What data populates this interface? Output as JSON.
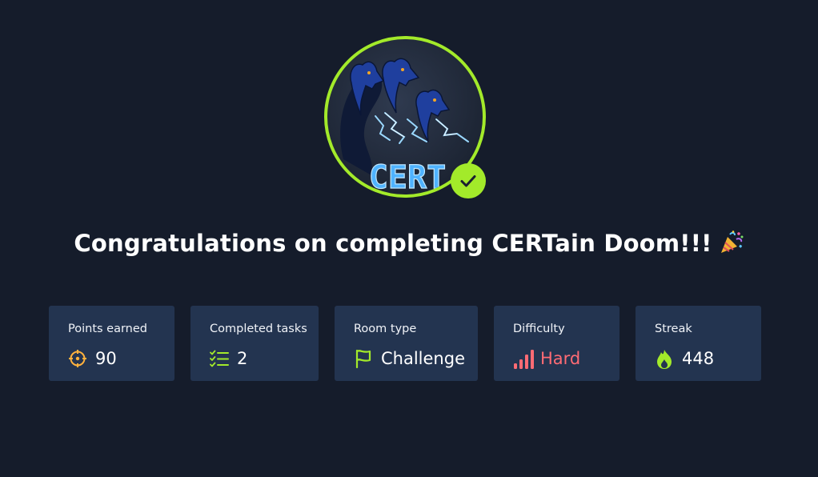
{
  "badge": {
    "text": "CERT",
    "completed": true
  },
  "title": {
    "text": "Congratulations on completing CERTain Doom!!!",
    "emoji": "party-popper"
  },
  "stats": [
    {
      "label": "Points earned",
      "value": "90",
      "icon": "crosshair-icon"
    },
    {
      "label": "Completed tasks",
      "value": "2",
      "icon": "checklist-icon"
    },
    {
      "label": "Room type",
      "value": "Challenge",
      "icon": "flag-icon"
    },
    {
      "label": "Difficulty",
      "value": "Hard",
      "icon": "signal-bars-icon"
    },
    {
      "label": "Streak",
      "value": "448",
      "icon": "flame-icon"
    }
  ],
  "colors": {
    "background": "#151c2b",
    "card": "#233450",
    "accent": "#a3ea2a",
    "points_icon": "#ffb13d",
    "hard": "#ff6b74"
  }
}
